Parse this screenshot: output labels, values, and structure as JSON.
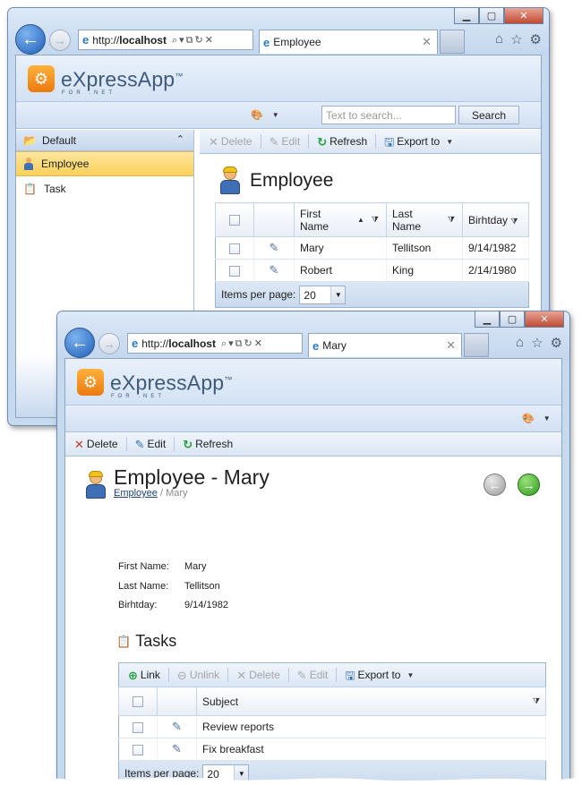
{
  "back_window": {
    "address": "http://localhost",
    "tab_title": "Employee",
    "app_name": "eXpressApp",
    "app_trademark": "™",
    "app_sub": "FOR .NET",
    "search_placeholder": "Text to search...",
    "search_button": "Search",
    "nav_group": "Default",
    "nav_items": [
      "Employee",
      "Task"
    ],
    "actions": {
      "delete": "Delete",
      "edit": "Edit",
      "refresh": "Refresh",
      "export": "Export to"
    },
    "view_title": "Employee",
    "columns": [
      "First Name",
      "Last Name",
      "Birhtday"
    ],
    "rows": [
      {
        "first": "Mary",
        "last": "Tellitson",
        "birthday": "9/14/1982"
      },
      {
        "first": "Robert",
        "last": "King",
        "birthday": "2/14/1980"
      }
    ],
    "pager_label": "Items per page:",
    "page_size": "20"
  },
  "front_window": {
    "address": "http://localhost",
    "tab_title": "Mary",
    "app_name": "eXpressApp",
    "app_trademark": "™",
    "app_sub": "FOR .NET",
    "actions": {
      "delete": "Delete",
      "edit": "Edit",
      "refresh": "Refresh"
    },
    "detail_title": "Employee - Mary",
    "breadcrumb_link": "Employee",
    "breadcrumb_sep": " / ",
    "breadcrumb_current": "Mary",
    "fields": [
      {
        "label": "First Name:",
        "value": "Mary"
      },
      {
        "label": "Last Name:",
        "value": "Tellitson"
      },
      {
        "label": "Birhtday:",
        "value": "9/14/1982"
      }
    ],
    "tasks_title": "Tasks",
    "tasks_actions": {
      "link": "Link",
      "unlink": "Unlink",
      "delete": "Delete",
      "edit": "Edit",
      "export": "Export to"
    },
    "tasks_column": "Subject",
    "tasks_rows": [
      "Review reports",
      "Fix breakfast"
    ],
    "pager_label": "Items per page:",
    "page_size": "20"
  }
}
